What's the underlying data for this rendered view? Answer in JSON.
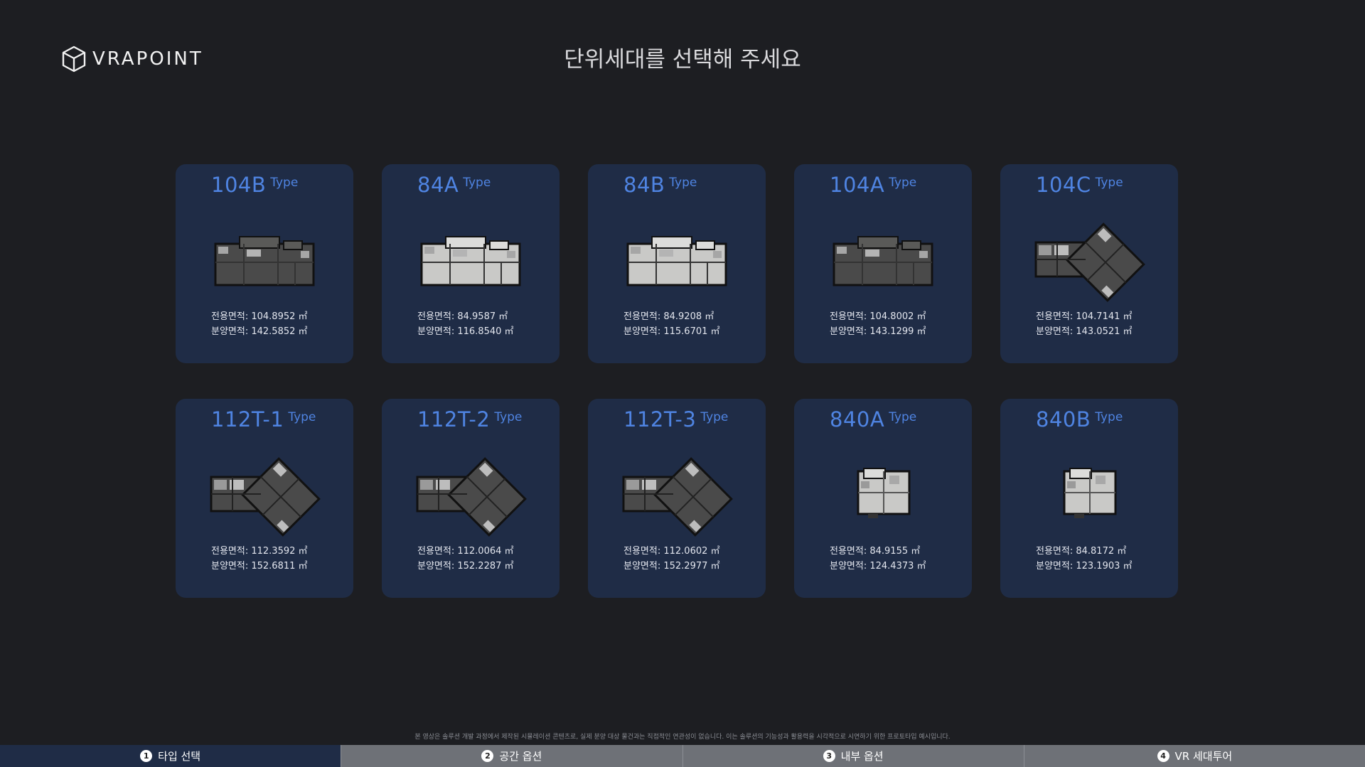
{
  "header": {
    "logo_text": "VRAPOINT",
    "logo_icon": "cube-icon",
    "title": "단위세대를 선택해 주세요"
  },
  "cards": [
    {
      "name": "104B",
      "type_label": "Type",
      "exclusive": "전용면적: 104.8952 ㎡",
      "supply": "분양면적: 142.5852 ㎡",
      "plan_style": "dark-wide"
    },
    {
      "name": "84A",
      "type_label": "Type",
      "exclusive": "전용면적: 84.9587 ㎡",
      "supply": "분양면적: 116.8540 ㎡",
      "plan_style": "light-wide"
    },
    {
      "name": "84B",
      "type_label": "Type",
      "exclusive": "전용면적: 84.9208 ㎡",
      "supply": "분양면적: 115.6701 ㎡",
      "plan_style": "light-wide"
    },
    {
      "name": "104A",
      "type_label": "Type",
      "exclusive": "전용면적: 104.8002 ㎡",
      "supply": "분양면적: 143.1299 ㎡",
      "plan_style": "dark-wide"
    },
    {
      "name": "104C",
      "type_label": "Type",
      "exclusive": "전용면적: 104.7141 ㎡",
      "supply": "분양면적: 143.0521 ㎡",
      "plan_style": "dark-angled"
    },
    {
      "name": "112T-1",
      "type_label": "Type",
      "exclusive": "전용면적: 112.3592 ㎡",
      "supply": "분양면적: 152.6811 ㎡",
      "plan_style": "dark-angled"
    },
    {
      "name": "112T-2",
      "type_label": "Type",
      "exclusive": "전용면적: 112.0064 ㎡",
      "supply": "분양면적: 152.2287 ㎡",
      "plan_style": "dark-angled"
    },
    {
      "name": "112T-3",
      "type_label": "Type",
      "exclusive": "전용면적: 112.0602 ㎡",
      "supply": "분양면적: 152.2977 ㎡",
      "plan_style": "dark-angled"
    },
    {
      "name": "840A",
      "type_label": "Type",
      "exclusive": "전용면적: 84.9155 ㎡",
      "supply": "분양면적: 124.4373 ㎡",
      "plan_style": "light-compact"
    },
    {
      "name": "840B",
      "type_label": "Type",
      "exclusive": "전용면적: 84.8172 ㎡",
      "supply": "분양면적: 123.1903 ㎡",
      "plan_style": "light-compact"
    }
  ],
  "disclaimer": "본 영상은 솔루션 개발 과정에서 제작된 시뮬레이션 콘텐츠로, 실제 분양 대상 물건과는 직접적인 연관성이 없습니다. 이는 솔루션의 기능성과 활용력을 시각적으로 시연하기 위한 프로토타입 예시입니다.",
  "tabs": [
    {
      "num": "1",
      "label": "타입 선택",
      "active": true
    },
    {
      "num": "2",
      "label": "공간 옵션",
      "active": false
    },
    {
      "num": "3",
      "label": "내부 옵션",
      "active": false
    },
    {
      "num": "4",
      "label": "VR 세대투어",
      "active": false
    }
  ],
  "colors": {
    "background": "#1d1e22",
    "card": "#1f2c46",
    "accent": "#4f84e2",
    "tab_inactive": "#6e7177"
  }
}
